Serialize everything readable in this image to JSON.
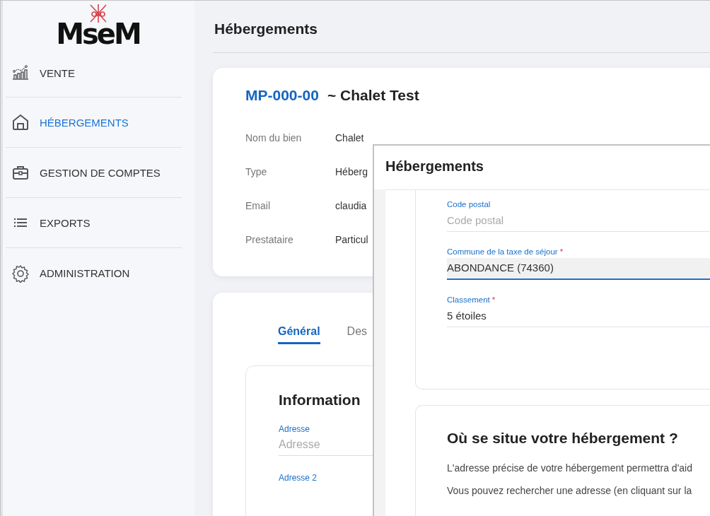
{
  "sidebar": {
    "logo": "MseM",
    "items": [
      {
        "label": "VENTE",
        "selected": false
      },
      {
        "label": "HÉBERGEMENTS",
        "selected": true
      },
      {
        "label": "GESTION DE COMPTES",
        "selected": false
      },
      {
        "label": "EXPORTS",
        "selected": false
      },
      {
        "label": "ADMINISTRATION",
        "selected": false
      }
    ]
  },
  "page": {
    "title": "Hébergements",
    "property": {
      "code": "MP-000-00",
      "name": "~ Chalet Test",
      "fields": [
        {
          "label": "Nom du bien",
          "value": "Chalet"
        },
        {
          "label": "Type",
          "value": "Héberg"
        },
        {
          "label": "Email",
          "value": "claudia"
        },
        {
          "label": "Prestataire",
          "value": "Particul"
        }
      ]
    },
    "tabs": [
      {
        "label": "Général",
        "selected": true
      },
      {
        "label": "Des",
        "selected": false
      }
    ],
    "section": {
      "title": "Information",
      "fields": [
        {
          "label": "Adresse",
          "placeholder": "Adresse"
        },
        {
          "label": "Adresse 2"
        }
      ]
    }
  },
  "dialog": {
    "title": "Hébergements",
    "fields": [
      {
        "label": "Code postal",
        "placeholder": "Code postal",
        "focused": false
      },
      {
        "label": "Commune de la taxe de séjour",
        "required_mark": "*",
        "value": "ABONDANCE (74360)",
        "focused": true
      },
      {
        "label": "Classement",
        "required_mark": "*",
        "value": "5 étoiles",
        "focused": false
      }
    ],
    "section": {
      "title": "Où se situe votre hébergement ?",
      "paragraphs": [
        "L'adresse précise de votre hébergement permettra d'aid",
        "Vous pouvez rechercher une adresse (en cliquant sur la"
      ]
    }
  }
}
